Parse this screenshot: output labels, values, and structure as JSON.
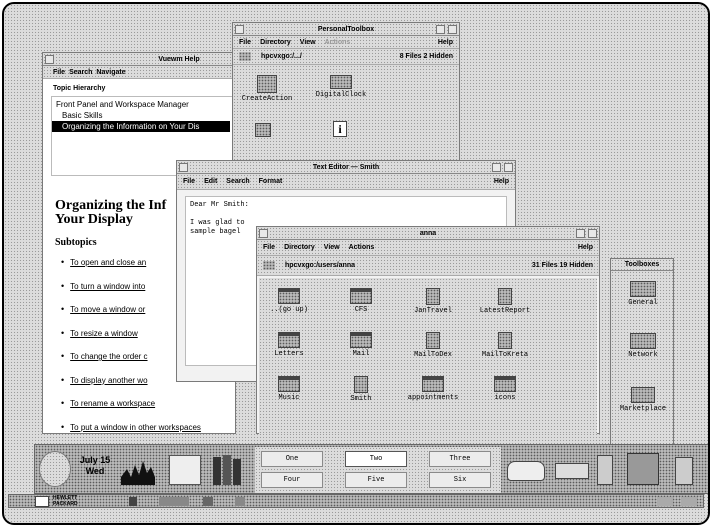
{
  "viewer_window": {
    "title": "Vuewm Help",
    "menus": [
      "File",
      "Search",
      "Navigate"
    ],
    "topic_hierarchy_label": "Topic Hierarchy",
    "topics": [
      "Front Panel and Workspace Manager",
      "Basic Skills",
      "Organizing the Information on Your Dis"
    ],
    "heading_line1": "Organizing the Inf",
    "heading_line2": "Your Display",
    "subtopics_label": "Subtopics",
    "subtopic_links": [
      "To open and close an",
      "To turn a window into",
      "To move a window or",
      "To resize a window",
      "To change the order c",
      "To display another wo",
      "To rename a workspace",
      "To put a window in other workspaces"
    ]
  },
  "toolbox_window": {
    "title": "PersonalToolbox",
    "menus": [
      "File",
      "Directory",
      "View",
      "Actions"
    ],
    "help": "Help",
    "path": "hpcvxgo:/.../",
    "count": "8 Files 2 Hidden",
    "icons": [
      "CreateAction",
      "DigitalClock"
    ]
  },
  "editor_window": {
    "title": "Text Editor — Smith",
    "menus": [
      "File",
      "Edit",
      "Search",
      "Format"
    ],
    "help": "Help",
    "lines": [
      "Dear Mr Smith:",
      "",
      "I was glad to",
      "sample bagel"
    ]
  },
  "anna_window": {
    "title": "anna",
    "menus": [
      "File",
      "Directory",
      "View",
      "Actions"
    ],
    "help": "Help",
    "path": "hpcvxgo:/users/anna",
    "count": "31 Files 19 Hidden",
    "icons": [
      {
        "label": "..(go up)",
        "kind": "folder"
      },
      {
        "label": "CFS",
        "kind": "folder"
      },
      {
        "label": "JanTravel",
        "kind": "doc"
      },
      {
        "label": "LatestReport",
        "kind": "doc"
      },
      {
        "label": "Letters",
        "kind": "folder"
      },
      {
        "label": "Mail",
        "kind": "folder"
      },
      {
        "label": "MailToDex",
        "kind": "doc"
      },
      {
        "label": "MailToKreta",
        "kind": "doc"
      },
      {
        "label": "Music",
        "kind": "folder"
      },
      {
        "label": "Smith",
        "kind": "doc"
      },
      {
        "label": "appointments",
        "kind": "folder"
      },
      {
        "label": "icons",
        "kind": "folder"
      }
    ]
  },
  "toolboxes_panel": {
    "title": "Toolboxes",
    "items": [
      "General",
      "Network",
      "Marketplace"
    ]
  },
  "front_panel": {
    "date_line1": "July 15",
    "date_line2": "Wed",
    "workspaces": [
      "One",
      "Two",
      "Three",
      "Four",
      "Five",
      "Six"
    ],
    "active_workspace": "Two",
    "brand_line1": "HEWLETT",
    "brand_line2": "PACKARD"
  },
  "icons": {
    "clock": "clock-icon",
    "load": "cpu-load-icon",
    "calendar": "calendar-icon",
    "books": "books-icon",
    "car": "car-icon",
    "printer": "printer-icon",
    "trash": "trash-icon",
    "tools": "tools-icon",
    "lock": "lock-icon",
    "mail": "mail-icon"
  }
}
